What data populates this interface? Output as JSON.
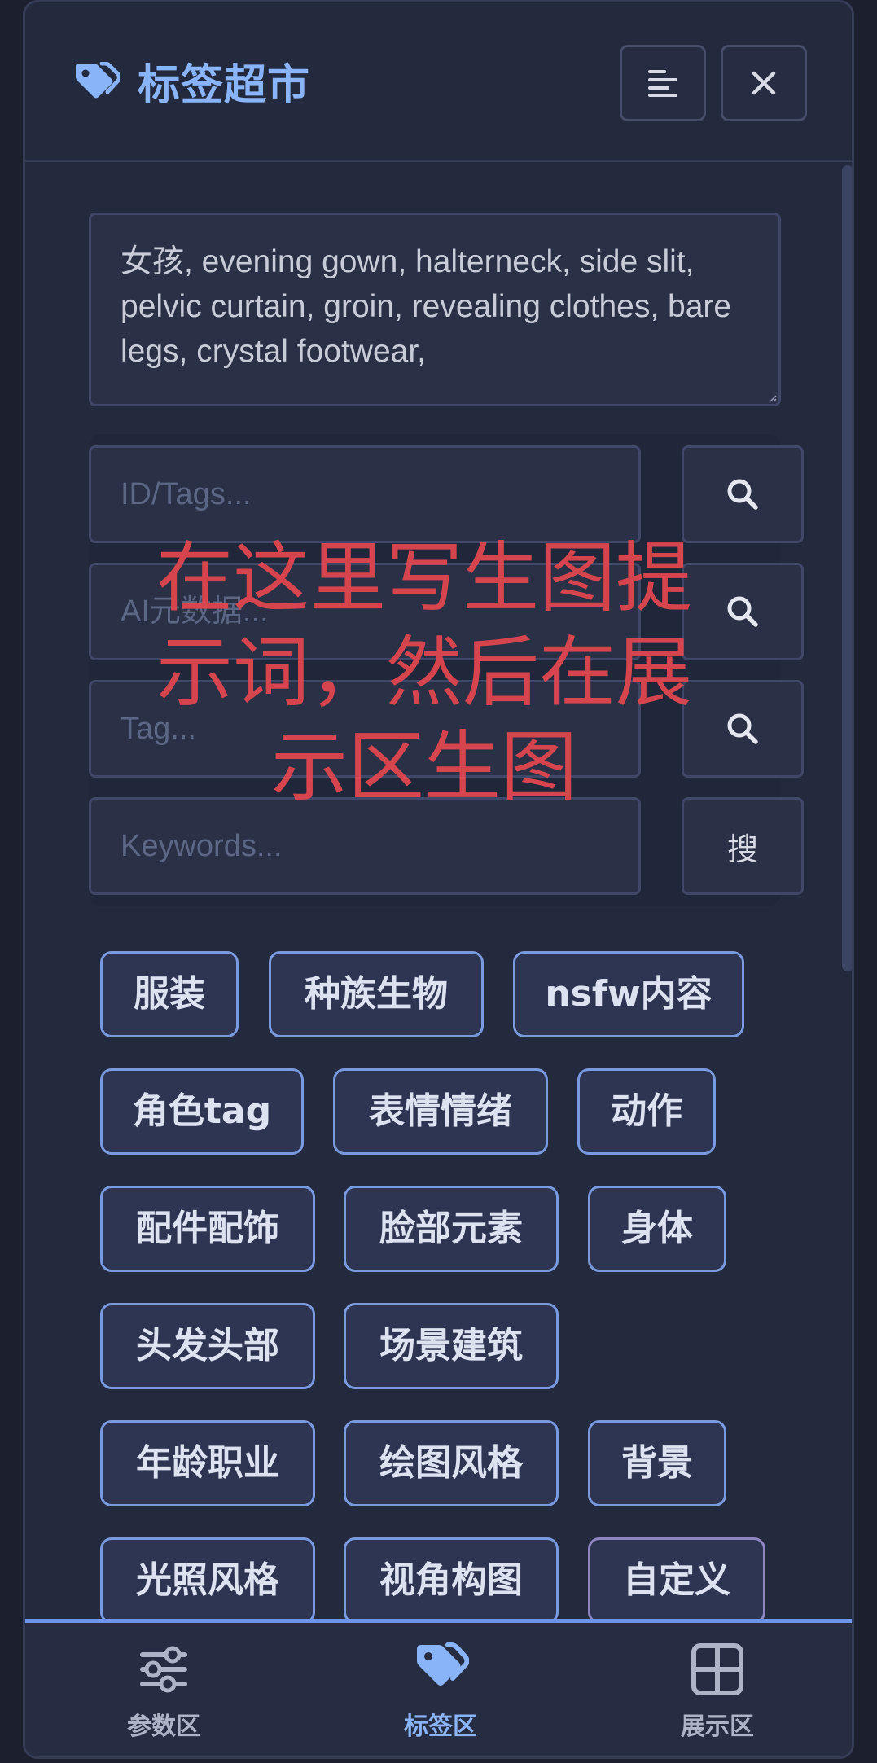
{
  "header": {
    "title": "标签超市",
    "icon": "tag-icon",
    "menu_icon": "align-left-icon",
    "close_icon": "close-icon"
  },
  "prompt": {
    "value": "女孩, evening gown, halterneck, side slit, pelvic curtain, groin, revealing clothes, bare legs, crystal footwear,"
  },
  "search": {
    "rows": [
      {
        "placeholder": "ID/Tags...",
        "button": "search-icon"
      },
      {
        "placeholder": "AI元数据...",
        "button": "search-icon"
      },
      {
        "placeholder": "Tag...",
        "button": "search-icon"
      },
      {
        "placeholder": "Keywords...",
        "button_label": "搜"
      }
    ]
  },
  "overlay_text": {
    "line1": "在这里写生图提",
    "line2": "示词，然后在展",
    "line3": "示区生图"
  },
  "tags": [
    "服装",
    "种族生物",
    "nsfw内容",
    "角色tag",
    "表情情绪",
    "动作",
    "配件配饰",
    "脸部元素",
    "身体",
    "头发头部",
    "场景建筑",
    "年龄职业",
    "绘图风格",
    "背景",
    "光照风格",
    "视角构图",
    "自定义"
  ],
  "nav": {
    "items": [
      {
        "label": "参数区",
        "icon": "sliders-icon",
        "active": false
      },
      {
        "label": "标签区",
        "icon": "tag-icon",
        "active": true
      },
      {
        "label": "展示区",
        "icon": "grid-icon",
        "active": false
      }
    ]
  },
  "colors": {
    "accent": "#8ab4f8",
    "panel_bg": "#242a3e",
    "overlay_text": "#e0464f",
    "tag_border": "#7a9ae0"
  }
}
